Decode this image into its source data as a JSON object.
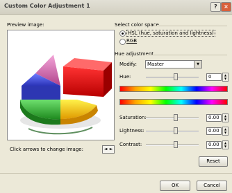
{
  "dialog": {
    "title": "Custom Color Adjustment 1",
    "help_label": "?",
    "close_label": "×"
  },
  "preview": {
    "label": "Preview image:",
    "hint": "Click arrows to change image:",
    "prev_arrow": "◄",
    "next_arrow": "►"
  },
  "color_space": {
    "group_label": "Select color space",
    "options": [
      {
        "label": "HSL (hue, saturation and lightness)",
        "selected": true
      },
      {
        "label": "RGB",
        "selected": false
      }
    ]
  },
  "hue_adjustment": {
    "group_label": "Hue adjustment",
    "modify_label": "Modify:",
    "modify_value": "Master",
    "hue_label": "Hue:",
    "hue_value": "0",
    "saturation_label": "Saturation:",
    "saturation_value": "0.00",
    "lightness_label": "Lightness:",
    "lightness_value": "0.00",
    "contrast_label": "Contrast:",
    "contrast_value": "0.00",
    "reset_label": "Reset"
  },
  "footer": {
    "ok_label": "OK",
    "cancel_label": "Cancel"
  }
}
